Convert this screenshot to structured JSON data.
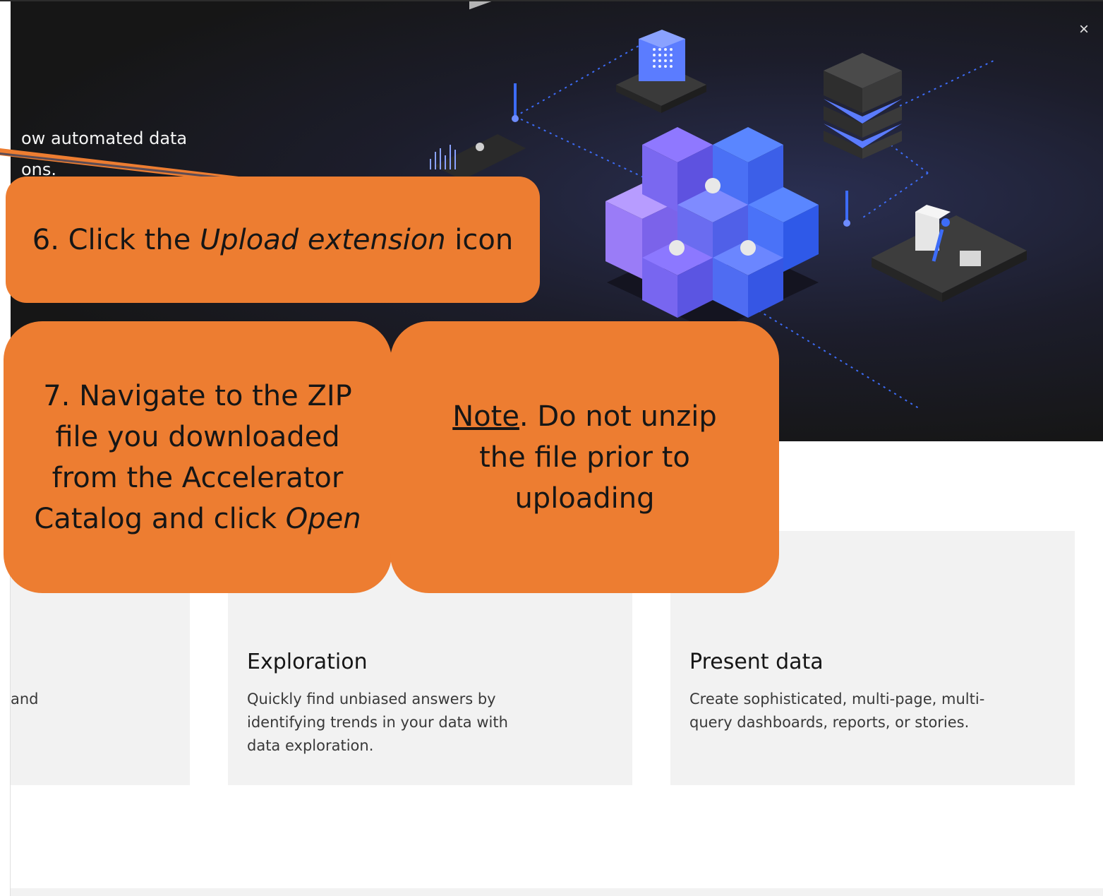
{
  "hero": {
    "partial_line_1": "ow automated data",
    "partial_line_2": "ons.",
    "close_label": "×"
  },
  "cards": [
    {
      "title": "",
      "desc": "and"
    },
    {
      "title": "Exploration",
      "desc": "Quickly find unbiased answers by identifying trends in your data with data exploration."
    },
    {
      "title": "Present data",
      "desc": "Create sophisticated, multi-page, multi-query dashboards, reports, or stories."
    }
  ],
  "callouts": {
    "step6": {
      "prefix": "6. Click the ",
      "italic": "Upload extension",
      "suffix": " icon"
    },
    "step7": {
      "prefix": "7. Navigate to the ZIP file you downloaded from the Accelerator Catalog and click ",
      "italic": "Open"
    },
    "note": {
      "underlined": "Note",
      "rest": ". Do not unzip the file prior to uploading"
    }
  },
  "colors": {
    "callout": "#ed7d31",
    "hero_bg": "#161616",
    "card_bg": "#f2f2f2",
    "cube_purple": "#8a6cf5",
    "cube_blue": "#4a6cf7"
  }
}
